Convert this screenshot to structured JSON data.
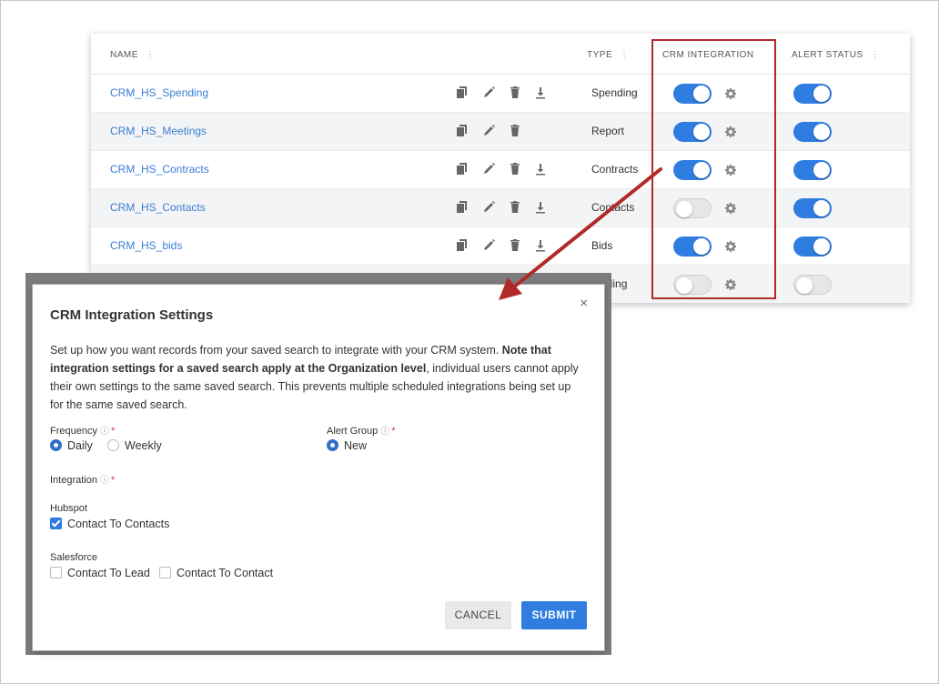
{
  "table": {
    "headers": {
      "name": "NAME",
      "type": "TYPE",
      "crm_integration": "CRM INTEGRATION",
      "alert_status": "ALERT STATUS",
      "kebab": "⋮"
    },
    "rows": [
      {
        "name": "CRM_HS_Spending",
        "type": "Spending",
        "crm_on": true,
        "alert_on": true,
        "download": true
      },
      {
        "name": "CRM_HS_Meetings",
        "type": "Report",
        "crm_on": true,
        "alert_on": true,
        "download": false
      },
      {
        "name": "CRM_HS_Contracts",
        "type": "Contracts",
        "crm_on": true,
        "alert_on": true,
        "download": true
      },
      {
        "name": "CRM_HS_Contacts",
        "type": "Contacts",
        "crm_on": false,
        "alert_on": true,
        "download": true
      },
      {
        "name": "CRM_HS_bids",
        "type": "Bids",
        "crm_on": true,
        "alert_on": true,
        "download": true
      },
      {
        "name": "",
        "type": "nding",
        "crm_on": false,
        "alert_on": false,
        "download": false
      }
    ]
  },
  "modal": {
    "close": "×",
    "title": "CRM Integration Settings",
    "desc_pre": "Set up how you want records from your saved search to integrate with your CRM system. ",
    "desc_bold": "Note that integration settings for a saved search apply at the Organization level",
    "desc_post": ", individual users cannot apply their own settings to the same saved search. This prevents multiple scheduled integrations being set up for the same saved search.",
    "frequency_label": "Frequency",
    "frequency_options": [
      "Daily",
      "Weekly"
    ],
    "frequency_selected": "Daily",
    "alert_group_label": "Alert Group",
    "alert_group_option": "New",
    "integration_label": "Integration",
    "hubspot_label": "Hubspot",
    "hubspot_option": "Contact To Contacts",
    "salesforce_label": "Salesforce",
    "salesforce_options": [
      "Contact To Lead",
      "Contact To Contact"
    ],
    "cancel": "CANCEL",
    "submit": "SUBMIT",
    "info_symbol": "ⓘ",
    "required_symbol": "*"
  },
  "colors": {
    "accent": "#2f7de1",
    "link": "#3a7cd6",
    "highlight": "#b02a2a"
  }
}
